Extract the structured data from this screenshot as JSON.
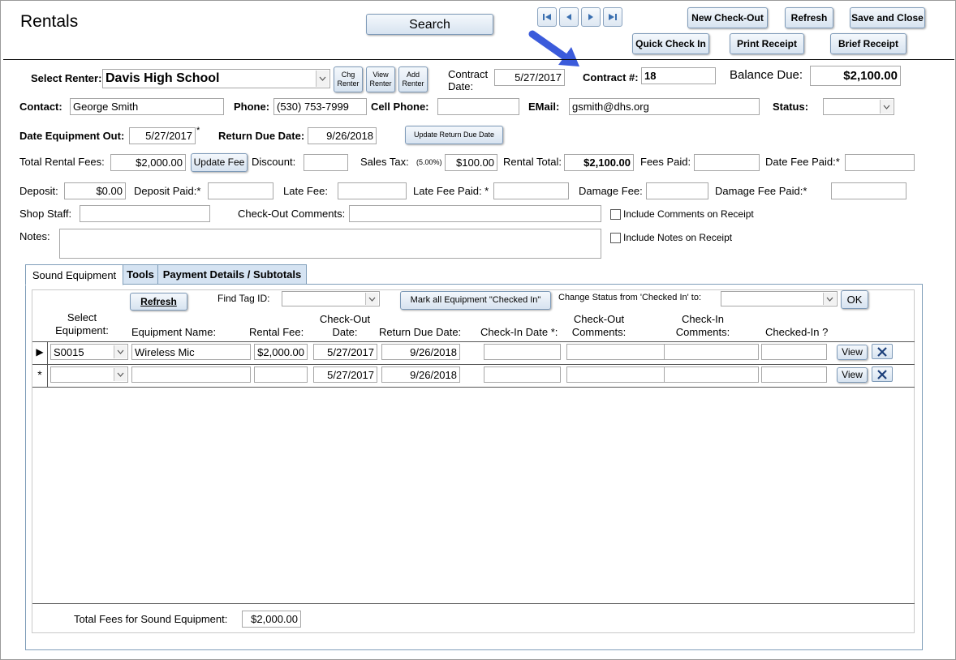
{
  "window": {
    "title": "Rentals"
  },
  "toolbar": {
    "search": "Search",
    "new_checkout": "New Check-Out",
    "refresh": "Refresh",
    "save_close": "Save and Close",
    "quick_check_in": "Quick Check In",
    "print_receipt": "Print Receipt",
    "brief_receipt": "Brief Receipt"
  },
  "form": {
    "select_renter_label": "Select Renter:",
    "select_renter_value": "Davis High School",
    "chg_renter": "Chg Renter",
    "view_renter": "View Renter",
    "add_renter": "Add Renter",
    "contract_date_label": "Contract Date:",
    "contract_date": "5/27/2017",
    "contract_no_label": "Contract #:",
    "contract_no": "18",
    "balance_due_label": "Balance Due:",
    "balance_due": "$2,100.00",
    "contact_label": "Contact:",
    "contact": "George Smith",
    "phone_label": "Phone:",
    "phone": "(530) 753-7999",
    "cell_label": "Cell Phone:",
    "cell": "",
    "email_label": "EMail:",
    "email": "gsmith@dhs.org",
    "status_label": "Status:",
    "status": "",
    "date_out_label": "Date Equipment Out:",
    "date_out": "5/27/2017",
    "date_out_star": "*",
    "return_due_label": "Return Due Date:",
    "return_due": "9/26/2018",
    "update_return_due": "Update Return Due Date",
    "total_rental_fees_label": "Total Rental Fees:",
    "total_rental_fees": "$2,000.00",
    "update_fee": "Update Fee",
    "discount_label": "Discount:",
    "discount": "",
    "sales_tax_label": "Sales Tax:",
    "sales_tax_rate": "(5.00%)",
    "sales_tax": "$100.00",
    "rental_total_label": "Rental Total:",
    "rental_total": "$2,100.00",
    "fees_paid_label": "Fees Paid:",
    "fees_paid": "",
    "date_fee_paid_label": "Date Fee Paid:*",
    "date_fee_paid": "",
    "deposit_label": "Deposit:",
    "deposit": "$0.00",
    "deposit_paid_label": "Deposit Paid:*",
    "deposit_paid": "",
    "late_fee_label": "Late Fee:",
    "late_fee": "",
    "late_fee_paid_label": "Late Fee Paid: *",
    "late_fee_paid": "",
    "damage_fee_label": "Damage Fee:",
    "damage_fee": "",
    "damage_fee_paid_label": "Damage Fee Paid:*",
    "damage_fee_paid": "",
    "shop_staff_label": "Shop Staff:",
    "shop_staff": "",
    "checkout_comments_label": "Check-Out Comments:",
    "checkout_comments": "",
    "include_comments": "Include Comments on Receipt",
    "notes_label": "Notes:",
    "notes": "",
    "include_notes": "Include Notes on Receipt"
  },
  "tabs": [
    {
      "label": "Sound Equipment",
      "active": true
    },
    {
      "label": "Tools",
      "active": false
    },
    {
      "label": "Payment Details /  Subtotals",
      "active": false
    }
  ],
  "subform": {
    "refresh": "Refresh",
    "find_tag_label": "Find Tag ID:",
    "find_tag": "",
    "mark_all": "Mark all Equipment \"Checked In\"",
    "change_status_label": "Change Status from 'Checked In'  to:",
    "change_status": "",
    "ok": "OK",
    "columns": {
      "select_equipment": "Select Equipment:",
      "equipment_name": "Equipment Name:",
      "rental_fee": "Rental Fee:",
      "checkout_date": "Check-Out Date:",
      "return_due_date": "Return Due Date:",
      "checkin_date": "Check-In Date *:",
      "checkout_comments": "Check-Out Comments:",
      "checkin_comments": "Check-In Comments:",
      "checked_in": "Checked-In ?"
    },
    "rows": [
      {
        "selector": "▶",
        "equipment": "S0015",
        "name": "Wireless Mic",
        "fee": "$2,000.00",
        "checkout": "5/27/2017",
        "return_due": "9/26/2018",
        "checkin": "",
        "co_comments": "",
        "ci_comments": "",
        "checked_in": "",
        "view": "View"
      },
      {
        "selector": "*",
        "equipment": "",
        "name": "",
        "fee": "",
        "checkout": "5/27/2017",
        "return_due": "9/26/2018",
        "checkin": "",
        "co_comments": "",
        "ci_comments": "",
        "checked_in": "",
        "view": "View"
      }
    ],
    "total_label": "Total Fees for Sound Equipment:",
    "total": "$2,000.00"
  },
  "colors": {
    "arrow": "#3b5bdb",
    "tab_bg": "#d5e3f2",
    "border": "#7f9db9"
  }
}
